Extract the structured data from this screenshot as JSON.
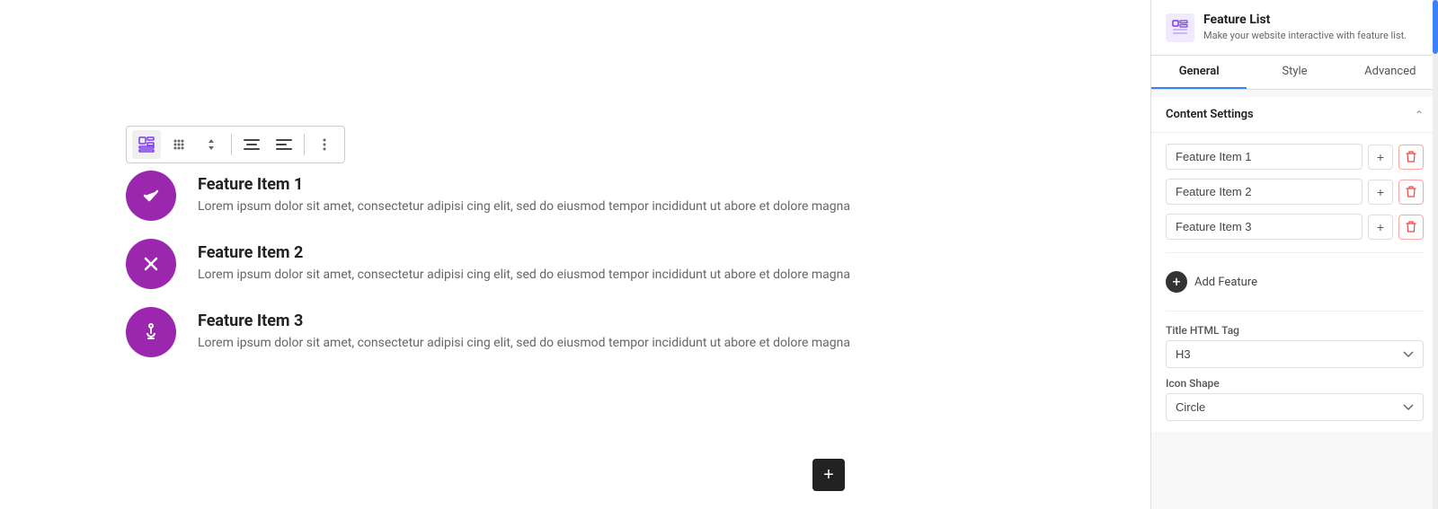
{
  "panel": {
    "icon_label": "FL",
    "title": "Feature List",
    "subtitle": "Make your website interactive with feature list.",
    "tabs": [
      {
        "id": "general",
        "label": "General",
        "active": true
      },
      {
        "id": "style",
        "label": "Style",
        "active": false
      },
      {
        "id": "advanced",
        "label": "Advanced",
        "active": false
      }
    ],
    "content_settings_label": "Content Settings",
    "features": [
      {
        "id": 1,
        "value": "Feature Item 1"
      },
      {
        "id": 2,
        "value": "Feature Item 2"
      },
      {
        "id": 3,
        "value": "Feature Item 3"
      }
    ],
    "add_feature_label": "Add Feature",
    "title_html_tag_label": "Title HTML Tag",
    "title_html_tag_value": "H3",
    "icon_shape_label": "Icon Shape",
    "icon_shape_value": "Circle"
  },
  "canvas": {
    "feature_items": [
      {
        "id": 1,
        "title": "Feature Item 1",
        "description": "Lorem ipsum dolor sit amet, consectetur adipisi cing elit, sed do eiusmod tempor incididunt ut abore et dolore magna",
        "icon_type": "check"
      },
      {
        "id": 2,
        "title": "Feature Item 2",
        "description": "Lorem ipsum dolor sit amet, consectetur adipisi cing elit, sed do eiusmod tempor incididunt ut abore et dolore magna",
        "icon_type": "x"
      },
      {
        "id": 3,
        "title": "Feature Item 3",
        "description": "Lorem ipsum dolor sit amet, consectetur adipisi cing elit, sed do eiusmod tempor incididunt ut abore et dolore magna",
        "icon_type": "anchor"
      }
    ],
    "add_btn_label": "+"
  },
  "toolbar": {
    "icons": [
      "widget",
      "move",
      "up-down",
      "align-center",
      "align-left",
      "more"
    ]
  }
}
